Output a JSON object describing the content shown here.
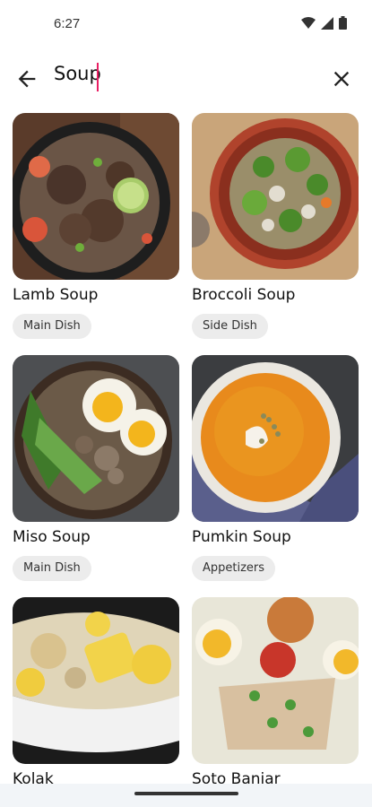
{
  "status": {
    "time": "6:27"
  },
  "search": {
    "query": "Soup"
  },
  "recipes": [
    {
      "title": "Lamb Soup",
      "tag": "Main Dish"
    },
    {
      "title": "Broccoli Soup",
      "tag": "Side Dish"
    },
    {
      "title": "Miso Soup",
      "tag": "Main Dish"
    },
    {
      "title": "Pumkin Soup",
      "tag": "Appetizers"
    },
    {
      "title": "Kolak",
      "tag": ""
    },
    {
      "title": "Soto Banjar",
      "tag": ""
    }
  ],
  "icons": {
    "back": "arrow-back-icon",
    "clear": "close-icon",
    "wifi": "wifi-icon",
    "signal": "signal-icon",
    "battery": "battery-icon"
  },
  "colors": {
    "caret": "#e91e63",
    "chip_bg": "#ececec"
  }
}
